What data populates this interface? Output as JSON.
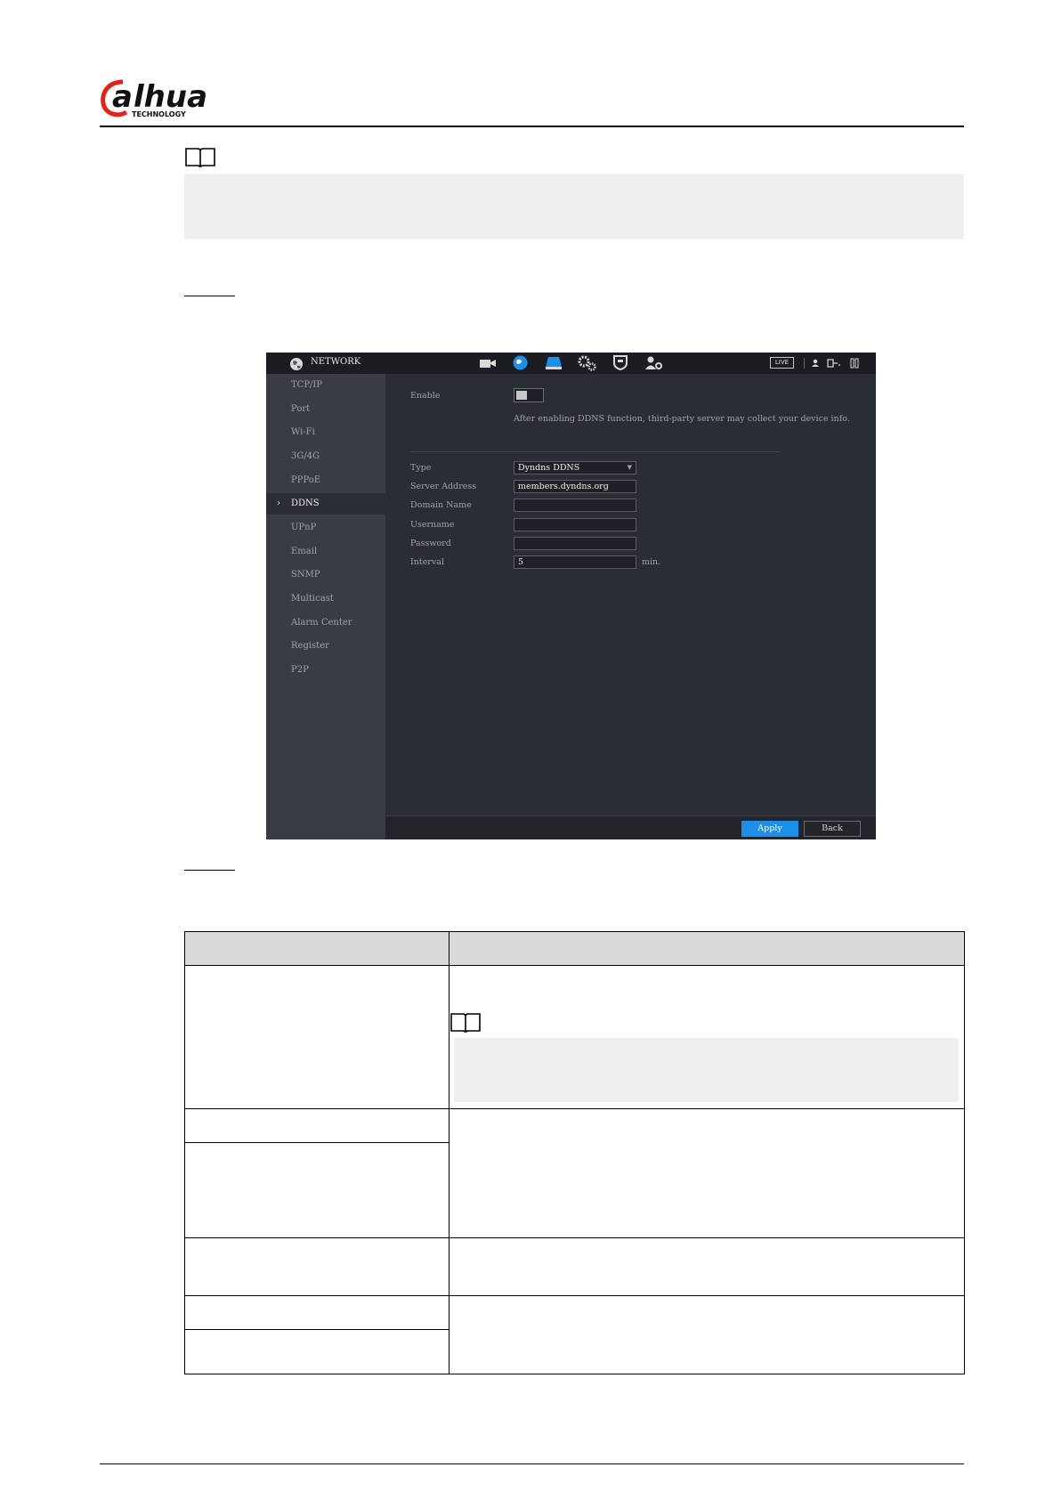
{
  "brand": {
    "logo_text": "alhua",
    "logo_sub": "TECHNOLOGY",
    "accent_color": "#e2231a"
  },
  "nvr": {
    "title": "NETWORK",
    "live_label": "LIVE",
    "sidebar": [
      {
        "label": "TCP/IP"
      },
      {
        "label": "Port"
      },
      {
        "label": "Wi-Fi"
      },
      {
        "label": "3G/4G"
      },
      {
        "label": "PPPoE"
      },
      {
        "label": "DDNS",
        "active": true
      },
      {
        "label": "UPnP"
      },
      {
        "label": "Email"
      },
      {
        "label": "SNMP"
      },
      {
        "label": "Multicast"
      },
      {
        "label": "Alarm Center"
      },
      {
        "label": "Register"
      },
      {
        "label": "P2P"
      }
    ],
    "enable_label": "Enable",
    "enable_hint": "After enabling DDNS function, third-party server may collect your device info.",
    "fields": {
      "type_label": "Type",
      "type_value": "Dyndns DDNS",
      "server_label": "Server Address",
      "server_value": "members.dyndns.org",
      "domain_label": "Domain Name",
      "domain_value": "",
      "username_label": "Username",
      "username_value": "",
      "password_label": "Password",
      "password_value": "",
      "interval_label": "Interval",
      "interval_value": "5",
      "interval_unit": "min."
    },
    "apply_label": "Apply",
    "back_label": "Back",
    "accent_color": "#1e8fe8"
  }
}
